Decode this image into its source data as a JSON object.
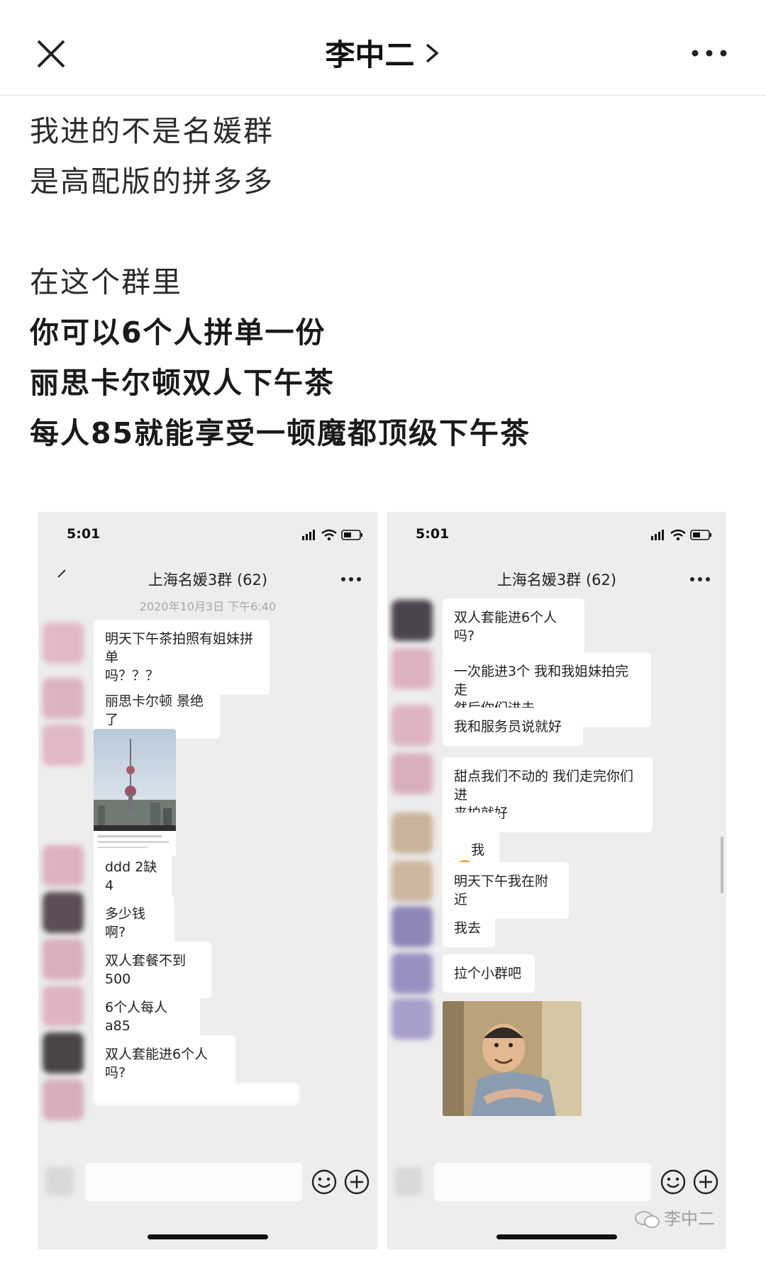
{
  "topbar": {
    "title": "李中二",
    "close_icon": "close-icon",
    "more_icon": "more-icon"
  },
  "article": {
    "lines": [
      {
        "text": "我进的不是名媛群",
        "bold": false
      },
      {
        "text": "是高配版的拼多多",
        "bold": false
      },
      {
        "text": "",
        "bold": false
      },
      {
        "text": "在这个群里",
        "bold": false
      },
      {
        "text": "你可以6个人拼单一份",
        "bold": true
      },
      {
        "text": "丽思卡尔顿双人下午茶",
        "bold": true
      },
      {
        "text": "每人85就能享受一顿魔都顶级下午茶",
        "bold": true
      }
    ]
  },
  "phone_left": {
    "time": "5:01",
    "chat_title": "上海名媛3群 (62)",
    "date": "2020年10月3日 下午6:40",
    "messages": [
      {
        "text": "明天下午茶拍照有姐妹拼单\n吗？？？"
      },
      {
        "text": "丽思卡尔顿 景绝了"
      },
      {
        "text": "ddd 2缺4"
      },
      {
        "text": "多少钱啊?"
      },
      {
        "text": "双人套餐不到500"
      },
      {
        "text": "6个人每人a85"
      },
      {
        "text": "双人套能进6个人吗?"
      }
    ]
  },
  "phone_right": {
    "time": "5:01",
    "chat_title": "上海名媛3群 (62)",
    "messages": [
      {
        "text": "双人套能进6个人吗?"
      },
      {
        "text": "一次能进3个 我和我姐妹拍完走\n然后你们进去"
      },
      {
        "text": "我和服务员说就好"
      },
      {
        "text": "甜点我们不动的 我们走完你们进\n来拍就好"
      },
      {
        "text": "我",
        "badge": "可"
      },
      {
        "text": "明天下午我在附近"
      },
      {
        "text": "我去"
      },
      {
        "text": "拉个小群吧"
      }
    ]
  },
  "watermark": {
    "text": "李中二"
  },
  "colors": {
    "chat_bg": "#ededed",
    "bubble": "#ffffff",
    "badge": "#f2a53c"
  }
}
